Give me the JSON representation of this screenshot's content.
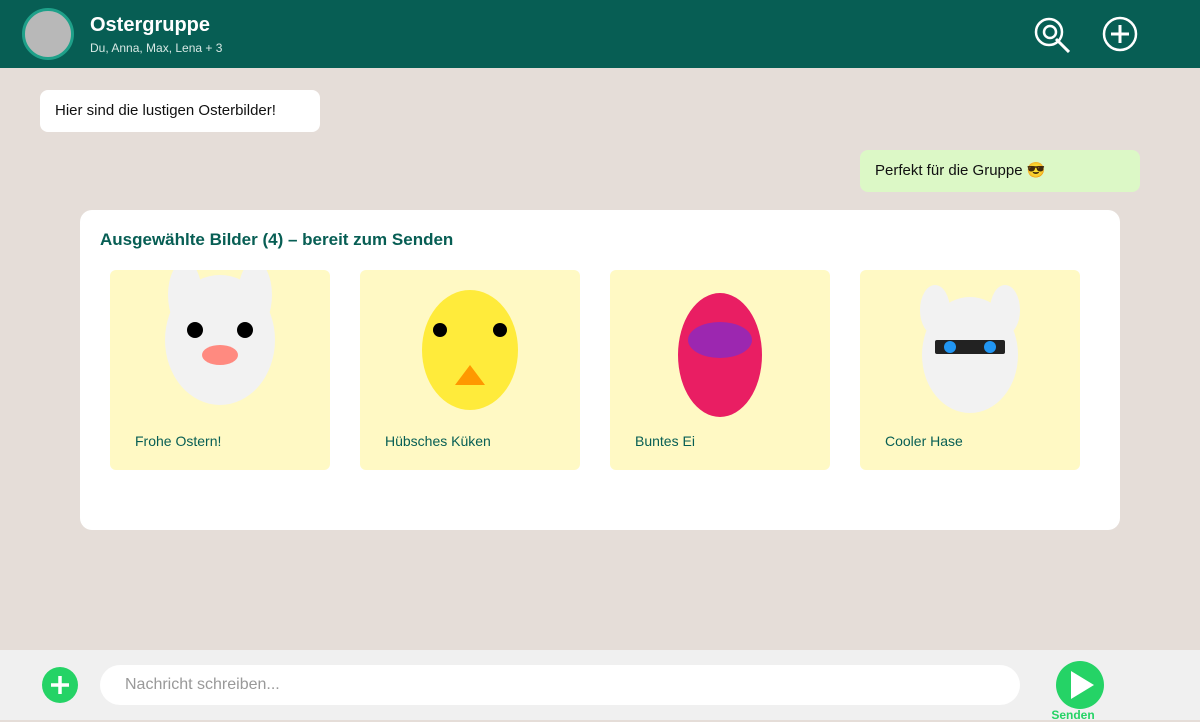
{
  "header": {
    "title": "Ostergruppe",
    "members": "Du, Anna, Max, Lena + 3",
    "icons": [
      "search-icon",
      "add-icon"
    ],
    "color": "#075e54"
  },
  "messages": [
    {
      "direction": "incoming",
      "text": "Hier sind die lustigen Osterbilder!"
    },
    {
      "direction": "outgoing",
      "text": "Perfekt für die Gruppe 😎"
    }
  ],
  "selection": {
    "title": "Ausgewählte Bilder (4) – bereit zum Senden",
    "images": [
      {
        "label": "Frohe Ostern!",
        "picture": "bunny"
      },
      {
        "label": "Hübsches Küken",
        "picture": "chick"
      },
      {
        "label": "Buntes Ei",
        "picture": "egg"
      },
      {
        "label": "Cooler Hase",
        "picture": "bunny-with-sunglasses"
      }
    ]
  },
  "composer": {
    "placeholder": "Nachricht schreiben...",
    "value": "",
    "send_label": "Senden",
    "accent": "#25d366"
  }
}
